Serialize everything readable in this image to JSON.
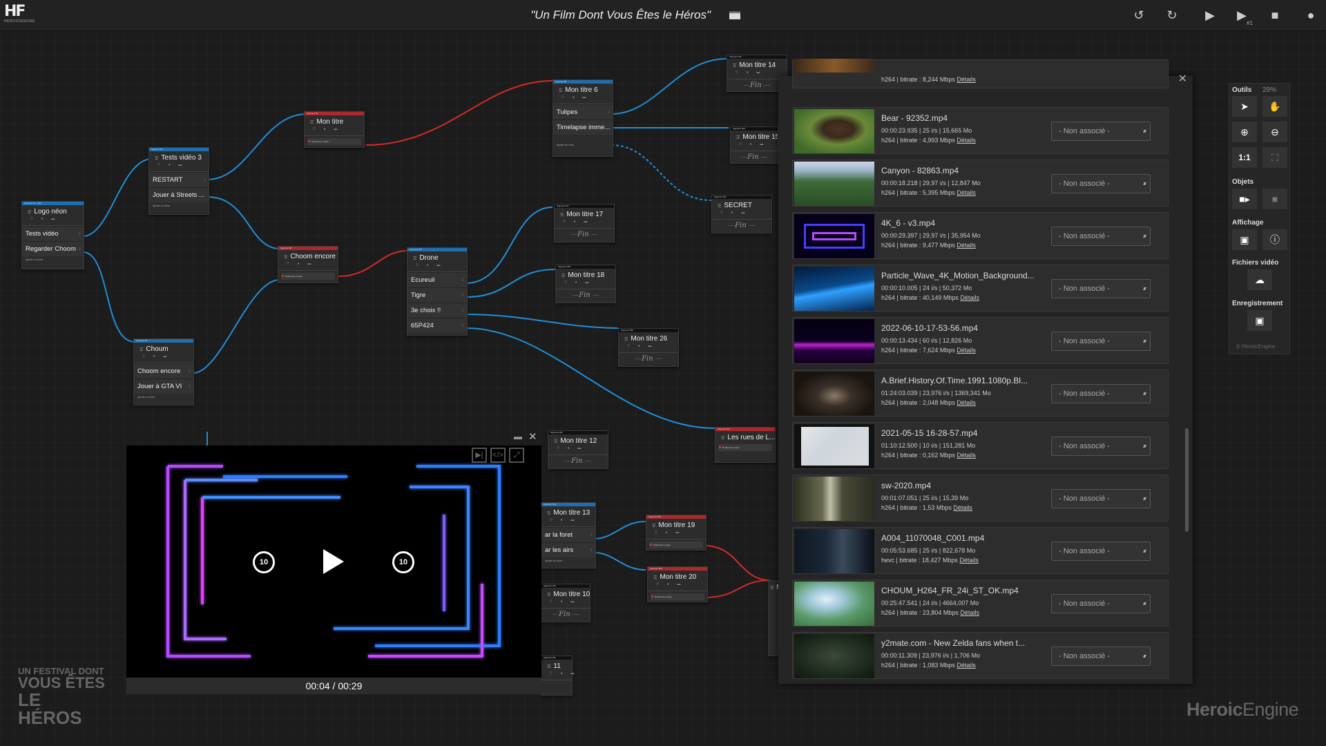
{
  "app": {
    "logo_big": "HF",
    "logo_small": "HEROICENGINE",
    "title": "\"Un Film Dont Vous Êtes le Héros\"",
    "title_icon": "clapperboard-icon",
    "toolbar": {
      "undo_icon": "undo-icon",
      "redo_icon": "redo-icon",
      "play_icon": "play-icon",
      "play_from_icon": "play-from-node-icon",
      "play_from_sub": "#1",
      "stop_icon": "stop-icon",
      "user_icon": "user-icon"
    }
  },
  "nodes": {
    "logo_neon": {
      "header": "Segment #1 - Start",
      "name": "Logo néon",
      "choices": [
        "Tests vidéo",
        "Regarder Choom"
      ],
      "add": "Ajouter un choix"
    },
    "tests_video_3": {
      "header": "Segment #2",
      "name": "Tests vidéo 3",
      "choices": [
        "RESTART",
        "Jouer à Streets ..."
      ],
      "add": "Ajouter un choix"
    },
    "mon_titre": {
      "header": "Segment #5",
      "name": "Mon titre",
      "redirect": "Redirection simple"
    },
    "mon_titre_6": {
      "header": "Segment #6",
      "name": "Mon titre 6",
      "choices": [
        "Tulipes",
        "Timelapse imme..."
      ],
      "add": "Ajouter un choix"
    },
    "mon_titre_14": {
      "header": "Segment #14",
      "name": "Mon titre 14",
      "fin": "Fin"
    },
    "mon_titre_15": {
      "header": "Segment #15",
      "name": "Mon titre 15",
      "fin": "Fin"
    },
    "secret": {
      "header": "Segment #27",
      "name": "SECRET",
      "fin": "Fin"
    },
    "choom_encore": {
      "header": "Segment #8",
      "name": "Choom encore",
      "redirect": "Redirection simple"
    },
    "drone": {
      "header": "Segment #16",
      "name": "Drone",
      "choices": [
        "Ecureuil",
        "Tigre",
        "3e choix !!",
        "65P424"
      ]
    },
    "mon_titre_17": {
      "header": "Segment #17",
      "name": "Mon titre 17",
      "fin": "Fin"
    },
    "mon_titre_18": {
      "header": "Segment #18",
      "name": "Mon titre 18",
      "fin": "Fin"
    },
    "mon_titre_26": {
      "header": "Segment #26",
      "name": "Mon titre 26",
      "fin": "Fin"
    },
    "choum": {
      "header": "Segment #3",
      "name": "Choum",
      "choices": [
        "Choom encore",
        "Jouer à GTA VI"
      ],
      "add": "Ajouter un choix"
    },
    "mon_titre_12": {
      "header": "Segment #12",
      "name": "Mon titre 12",
      "fin": "Fin"
    },
    "les_rues": {
      "header": "Segment #22",
      "name": "Les rues de L...",
      "redirect": "Redirection simple"
    },
    "mon_titre_13": {
      "header": "Segment #13",
      "name": "Mon titre 13",
      "choices": [
        "ar la foret",
        "ar les airs"
      ],
      "add": "Ajouter un choix"
    },
    "mon_titre_19": {
      "header": "Segment #19",
      "name": "Mon titre 19",
      "redirect": "Redirection simple"
    },
    "mon_titre_20": {
      "header": "Segment #20",
      "name": "Mon titre 20",
      "redirect": "Redirection simple"
    },
    "mon_titre_10": {
      "header": "Segment #10",
      "name": "Mon titre 10",
      "fin": "Fin"
    },
    "node_11": {
      "header": "Segment #11",
      "name": "11"
    },
    "mo_partial": {
      "name": "Mo"
    }
  },
  "player": {
    "time_current": "00:04",
    "time_sep": "/",
    "time_total": "00:29",
    "rewind_label": "10",
    "forward_label": "10",
    "minimize_icon": "minimize-icon",
    "close_icon": "close-icon",
    "next_icon": "next-icon",
    "code_icon": "code-icon",
    "fullscreen_icon": "fullscreen-icon"
  },
  "library": {
    "close_icon": "close-icon",
    "select_placeholder": "- Non associé -",
    "details_label": "Détails",
    "videos": [
      {
        "name": "",
        "meta": "",
        "codec": "h264 | bitrate : 8,244 Mbps"
      },
      {
        "name": "Bear - 92352.mp4",
        "meta": "00:00:23.935 | 25 i/s | 15,665 Mo",
        "codec": "h264 | bitrate : 4,993 Mbps"
      },
      {
        "name": "Canyon - 82863.mp4",
        "meta": "00:00:18.218 | 29,97 i/s | 12,847 Mo",
        "codec": "h264 | bitrate : 5,395 Mbps"
      },
      {
        "name": "4K_6 - v3.mp4",
        "meta": "00:00:29.397 | 29,97 i/s | 35,954 Mo",
        "codec": "h264 | bitrate : 9,477 Mbps"
      },
      {
        "name": "Particle_Wave_4K_Motion_Background...",
        "meta": "00:00:10.005 | 24 i/s | 50,372 Mo",
        "codec": "h264 | bitrate : 40,149 Mbps"
      },
      {
        "name": "2022-06-10-17-53-56.mp4",
        "meta": "00:00:13.434 | 60 i/s | 12,826 Mo",
        "codec": "h264 | bitrate : 7,624 Mbps"
      },
      {
        "name": "A.Brief.History.Of.Time.1991.1080p.Bl...",
        "meta": "01:24:03.039 | 23,976 i/s | 1369,341 Mo",
        "codec": "h264 | bitrate : 2,048 Mbps"
      },
      {
        "name": "2021-05-15 16-28-57.mp4",
        "meta": "01:10:12.500 | 10 i/s | 151,281 Mo",
        "codec": "h264 | bitrate : 0,162 Mbps"
      },
      {
        "name": "sw-2020.mp4",
        "meta": "00:01:07.051 | 25 i/s | 15,39 Mo",
        "codec": "h264 | bitrate : 1,53 Mbps"
      },
      {
        "name": "A004_11070048_C001.mp4",
        "meta": "00:05:53.685 | 25 i/s | 822,678 Mo",
        "codec": "hevc | bitrate : 18,427 Mbps"
      },
      {
        "name": "CHOUM_H264_FR_24i_ST_OK.mp4",
        "meta": "00:25:47.541 | 24 i/s | 4664,007 Mo",
        "codec": "h264 | bitrate : 23,804 Mbps"
      },
      {
        "name": "y2mate.com - New Zelda fans when t...",
        "meta": "00:00:11.309 | 23,976 i/s | 1,706 Mo",
        "codec": "h264 | bitrate : 1,083 Mbps"
      }
    ]
  },
  "tools": {
    "outils": "Outils",
    "zoom": "29%",
    "objets": "Objets",
    "affichage": "Affichage",
    "fichiers_video": "Fichiers vidéo",
    "enregistrement": "Enregistrement",
    "one_to_one": "1:1",
    "copyright": "© HeroicEngine"
  },
  "watermarks": {
    "fest_l1": "UN FESTIVAL DONT",
    "fest_l2": "VOUS ÊTES",
    "fest_l3": "LE HÉROS",
    "he_bold": "Heroic",
    "he_light": "Engine"
  },
  "colors": {
    "wire_blue": "#1e90d8",
    "wire_red": "#d62a2a",
    "header_blue": "#1f6fb0",
    "header_red": "#b0282a"
  }
}
